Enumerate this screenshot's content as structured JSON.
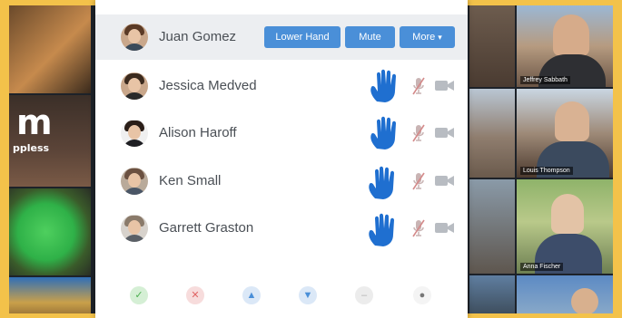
{
  "panel": {
    "participants": [
      {
        "name": "Juan Gomez",
        "selected": true,
        "avatar": "avatar-photo"
      },
      {
        "name": "Jessica Medved",
        "selected": false,
        "raised_hand": true,
        "avatar": "avatar-photo"
      },
      {
        "name": "Alison Haroff",
        "selected": false,
        "raised_hand": true,
        "avatar": "avatar-photo"
      },
      {
        "name": "Ken Small",
        "selected": false,
        "raised_hand": true,
        "avatar": "avatar-photo"
      },
      {
        "name": "Garrett Graston",
        "selected": false,
        "raised_hand": true,
        "avatar": "avatar-photo"
      }
    ],
    "row_actions": {
      "lower_hand_label": "Lower Hand",
      "mute_label": "Mute",
      "more_label": "More"
    }
  },
  "video_tiles": {
    "company_label": "m",
    "company_name": "ppless",
    "names": [
      "Jeffrey Sabbath",
      "Louis Thompson",
      "Anna Fischer"
    ]
  },
  "toolbar": {
    "buttons": [
      "check-icon",
      "close-icon",
      "thumbs-up-icon",
      "thumbs-down-icon",
      "minus-icon",
      "pin-icon"
    ]
  },
  "colors": {
    "accent": "#4a8fd8",
    "hand": "#1f6fd0",
    "background": "#f3c24a",
    "panel": "#ffffff"
  }
}
